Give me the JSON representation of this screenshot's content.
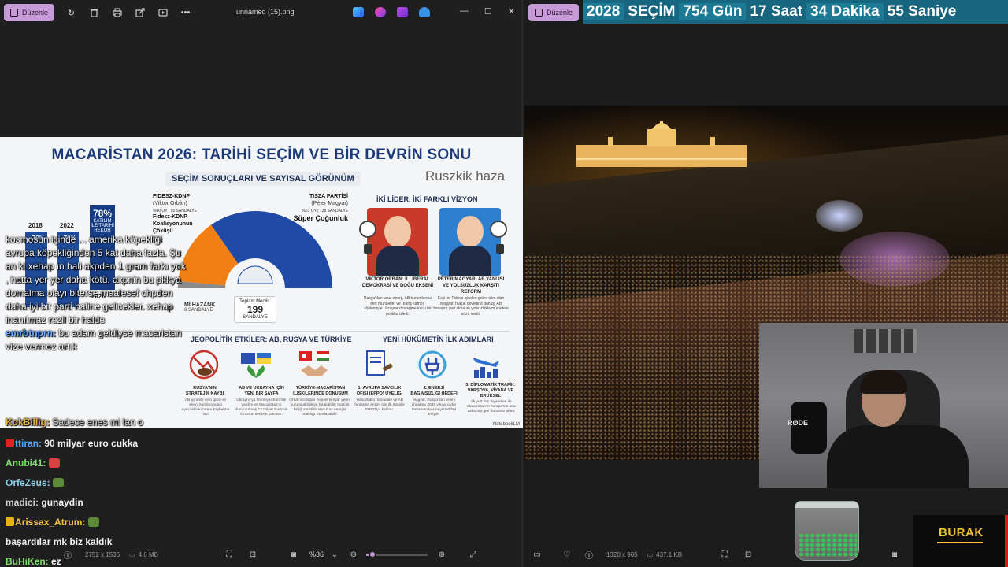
{
  "left_window": {
    "edit_label": "Düzenle",
    "file_title": "unnamed (15).png",
    "status": {
      "dimensions": "2752 x 1536",
      "size": "4.6 MB",
      "zoom": "%36",
      "zoom_fraction": 0.1
    }
  },
  "right_window": {
    "edit_label": "Düzenle",
    "banner": [
      "2028",
      "SEÇİM",
      "754 Gün",
      "17 Saat",
      "34 Dakika",
      "55 Saniye"
    ],
    "status": {
      "dimensions": "1320 x 965",
      "size": "437.1 KB"
    },
    "rode_label": "RØDE",
    "streamer_name": "BURAK"
  },
  "infographic": {
    "title": "MACARİSTAN 2026: TARİHİ SEÇİM VE BİR DEVRİN SONU",
    "subtitle": "SEÇİM SONUÇLARI VE SAYISAL GÖRÜNÜM",
    "watermark": "Ruszkik haza",
    "bars": {
      "years": [
        "2018",
        "2022",
        "2026"
      ],
      "values": [
        70,
        70,
        78
      ],
      "pct_labels": [
        "~70%",
        "~70%",
        ""
      ],
      "rekor_pct": "78%",
      "rekor_label": "KATILIM İLE TARİHİ REKOR"
    },
    "fidesz": {
      "name": "FIDESZ-KDNP",
      "leader": "(Viktor Orbán)",
      "seats": "%40 OY | 55 SANDALYE",
      "caption": "Fidesz-KDNP Koalisyonunun Çöküşü"
    },
    "tisza": {
      "name": "TISZA PARTİSİ",
      "leader": "(Péter Magyar)",
      "seats": "%51 OY | 138 SANDALYE",
      "caption": "Süper Çoğunluk"
    },
    "hazank": {
      "name": "Mİ HAZÁNK",
      "seats": "6 SANDALYE"
    },
    "parliament": {
      "label": "Toplam Meclis:",
      "value": "199",
      "unit": "SANDALYE"
    },
    "seat_chart": {
      "type": "pie",
      "categories": [
        "Mi Hazánk",
        "Fidesz-KDNP",
        "Tisza"
      ],
      "values": [
        6,
        55,
        138
      ],
      "colors": [
        "#8a8a8a",
        "#f07f14",
        "#1f4aa6"
      ]
    },
    "leaders_header": "İKİ LİDER, İKİ FARKLI VİZYON",
    "orban_caption": "VİKTOR ORBÁN: İLLİBERAL DEMOKRASİ VE DOĞU EKSENİ",
    "orban_desc": "Rusya'dan ucuz enerji, AB kurumlarına sert muhalefet ve \"barış kampı\" söylemiyle Ukrayna desteğine karşı bir politika izledi.",
    "magyar_caption": "PÉTER MAGYAR: AB YANLISI VE YOLSUZLUK KARŞITI REFORM",
    "magyar_desc": "Eski bir Fidesz içinden gelen isim olan Magyar, hukuk devletine dönüş, AB fonlarını geri alma ve yolsuzlukla mücadele sözü verdi.",
    "geo_header": "JEOPOLİTİK ETKİLER: AB, RUSYA VE TÜRKİYE",
    "geo_items": [
      {
        "title": "RUSYA'NIN STRATEJİK KAYBI",
        "desc": "AB içindeki veto gücü ve enerji koridorundaki ayrıcalıklı konumu kaybetme riski."
      },
      {
        "title": "AB VE UKRAYNA İÇİN YENİ BİR SAYFA",
        "desc": "Ukrayna'ya 90 milyar Euro'luk yardım ve Macaristan'ın dondurulmuş 17 milyar Euro'luk fonunun serbest kalması."
      },
      {
        "title": "TÜRKİYE-MACARİSTAN İLİŞKİLERİNDE DÖNÜŞÜM",
        "desc": "Orbán-Erdoğan \"kişisel kimya\" yerini kurumsal ilişkiye bırakabilir; ticari iş birliği sürebilir ama Rus enerjisi ortaklığı zayıflayabilir."
      }
    ],
    "steps_header": "YENİ HÜKÜMETİN İLK ADIMLARI",
    "step_items": [
      {
        "title": "1. AVRUPA SAVCILIK OFİSİ (EPPO) ÜYELİĞİ",
        "desc": "Yolsuzlukla mücadele ve AB fonlarına erişim için ilk öncelik EPPO'ya katılım."
      },
      {
        "title": "2. ENERJİ BAĞIMSIZLIĞI HEDEFİ",
        "desc": "Magyar, Rusya'dan enerji ithalatını 2035 yılına kadar tamamen kesmeyi taahhüt ediyor."
      },
      {
        "title": "3. DİPLOMATİK TRAFİK: VARŞOVA, VİYANA VE BRÜKSEL",
        "desc": "İlk yurt dışı ziyaretleri ile Macaristan'ın Avrupa'nın ana saflarına geri dönülme planı."
      }
    ],
    "credit": "NotebookLM"
  },
  "chat_overlay": [
    {
      "nick": "",
      "text": "kosmosun içinde ... amerika köpekliği avrupa köpekliğinden 5 kat daha fazla. Şu an ki xehap ın hali akpden 1 gram farkı yok , hatta yer yer daha kötü. akpnin bu pkkya domalma olayı biterse maalesef chpden daha iyi bir parti haline gelicekler. xehap inanılmaz rezil bir halde"
    },
    {
      "nick": "emrbtnprn:",
      "text": "bu adam geldiyse macaristan vize vermez artık"
    },
    {
      "nick": "KokBillig:",
      "text": "Sadece enes mi lan o"
    }
  ],
  "chat_messages": [
    {
      "nick": "ttiran:",
      "text": "90 milyar euro cukka",
      "nick_color": "#4fa3ff",
      "badge": "#d22",
      "emote": ""
    },
    {
      "nick": "Anubi41:",
      "text": "",
      "nick_color": "#7ee06a",
      "badge": "",
      "emote": "#d8413f"
    },
    {
      "nick": "OrfeZeus:",
      "text": "",
      "nick_color": "#8ad0e8",
      "badge": "",
      "emote": "#5c8a3a"
    },
    {
      "nick": "madici:",
      "text": "gunaydin",
      "nick_color": "#cfcfcf",
      "badge": "",
      "emote": ""
    },
    {
      "nick": "Arissax_Atrum:",
      "text": "",
      "nick_color": "#f5c542",
      "badge": "#e8b31a",
      "emote": "#5c8a3a"
    },
    {
      "nick": "",
      "text": "başardılar mk biz kaldık",
      "nick_color": "#ffffff",
      "badge": "",
      "emote": ""
    },
    {
      "nick": "BuHiKen:",
      "text": "ez",
      "nick_color": "#7ee06a",
      "badge": "",
      "emote": ""
    }
  ]
}
